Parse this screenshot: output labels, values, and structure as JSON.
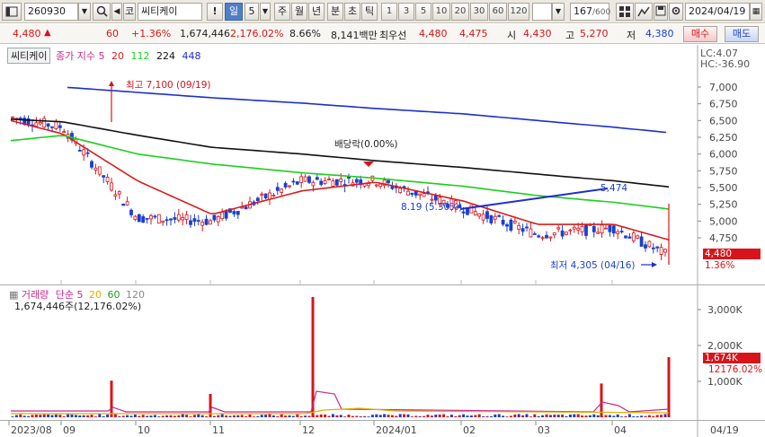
{
  "toolbar": {
    "code": "260930",
    "market_tag": "코",
    "name": "씨티케이",
    "warn": "!",
    "period_selected": "일",
    "period_num": "5",
    "periods": [
      "주",
      "월",
      "년",
      "분",
      "초",
      "틱"
    ],
    "intervals": [
      "1",
      "3",
      "5",
      "10",
      "20",
      "30",
      "60",
      "120"
    ],
    "count": "167",
    "count_max": "/600",
    "date": "2024/04/19"
  },
  "quote": {
    "price": "4,480",
    "change": "60",
    "change_pct": "+1.36%",
    "volume": "1,674,446",
    "vol_ratio": "2,176.02%",
    "turnover": "8.66%",
    "amount": "8,141백만",
    "best_label": "최우선",
    "best_ask": "4,480",
    "best_bid": "4,475",
    "open_label": "시",
    "open": "4,430",
    "high_label": "고",
    "high": "5,270",
    "low_label": "저",
    "low": "4,380",
    "buy_label": "매수",
    "sell_label": "매도"
  },
  "price_pane": {
    "name": "씨티케이",
    "indicator": "종가 지수",
    "ma_periods": [
      "5",
      "20",
      "112",
      "224",
      "448"
    ],
    "ma_colors": [
      "#c8288c",
      "#d81c1c",
      "#1ccf1c",
      "#111111",
      "#1c2fd0"
    ],
    "lc": "LC:4.07",
    "hc": "HC:-36.90",
    "high_note": "최고 7,100 (09/19)",
    "low_note": "최저 4,305 (04/16)",
    "dividend_note": "배당락(0.00%)",
    "trend_start_label": "8.19 (5.30%)",
    "trend_end_label": "5,474",
    "current_price": "4,480",
    "current_pct": "1.36%",
    "y_ticks": [
      "7,000",
      "6,750",
      "6,500",
      "6,250",
      "6,000",
      "5,750",
      "5,500",
      "5,250",
      "5,000",
      "4,750"
    ],
    "up_color": "#d8141b",
    "down_color": "#1a3fd0"
  },
  "volume_pane": {
    "title": "거래량",
    "ma_type": "단순",
    "ma_periods": [
      "5",
      "20",
      "60",
      "120"
    ],
    "ma_colors": [
      "#c8288c",
      "#e0b000",
      "#1c9c1c",
      "#888888"
    ],
    "summary": "1,674,446주(12,176.02%)",
    "y_ticks": [
      "3,000K",
      "2,000K",
      "1,000K"
    ],
    "current_vol": "1,674K",
    "current_pct": "12176.02%"
  },
  "x_axis": {
    "labels": [
      "2023/08",
      "09",
      "10",
      "11",
      "12",
      "2024/01",
      "02",
      "03",
      "04",
      "04/19"
    ]
  },
  "chart_data": [
    {
      "type": "line",
      "title": "",
      "xlabel": "",
      "ylabel": "",
      "ylim": [
        4200,
        7300
      ],
      "x": [
        "2023/08",
        "09",
        "10",
        "11",
        "12",
        "2024/01",
        "02",
        "03",
        "04",
        "04/19"
      ],
      "series": [
        {
          "name": "종가",
          "values": [
            6550,
            6400,
            5050,
            5000,
            5600,
            5600,
            5200,
            4800,
            4900,
            4480
          ]
        },
        {
          "name": "20",
          "values": [
            6500,
            6300,
            5600,
            5100,
            5450,
            5580,
            5300,
            4950,
            4950,
            4720
          ]
        },
        {
          "name": "112",
          "values": [
            6200,
            6280,
            6000,
            5850,
            5720,
            5640,
            5520,
            5380,
            5280,
            5180
          ]
        },
        {
          "name": "224",
          "values": [
            6520,
            6480,
            6280,
            6100,
            6000,
            5900,
            5800,
            5700,
            5600,
            5510
          ]
        },
        {
          "name": "448",
          "values": [
            7090,
            7000,
            6920,
            6840,
            6760,
            6680,
            6600,
            6500,
            6400,
            6320
          ]
        }
      ],
      "annotations": [
        "최고 7,100 (09/19)",
        "최저 4,305 (04/16)",
        "배당락(0.00%)"
      ]
    },
    {
      "type": "bar",
      "title": "거래량",
      "xlabel": "",
      "ylabel": "",
      "ylim": [
        0,
        3500
      ],
      "x": [
        "2023/08",
        "09",
        "10",
        "11",
        "12",
        "2024/01",
        "02",
        "03",
        "04",
        "04/19"
      ],
      "series": [
        {
          "name": "거래량 (K)",
          "values": [
            180,
            1020,
            60,
            650,
            3350,
            140,
            80,
            60,
            940,
            1674
          ]
        }
      ]
    }
  ]
}
